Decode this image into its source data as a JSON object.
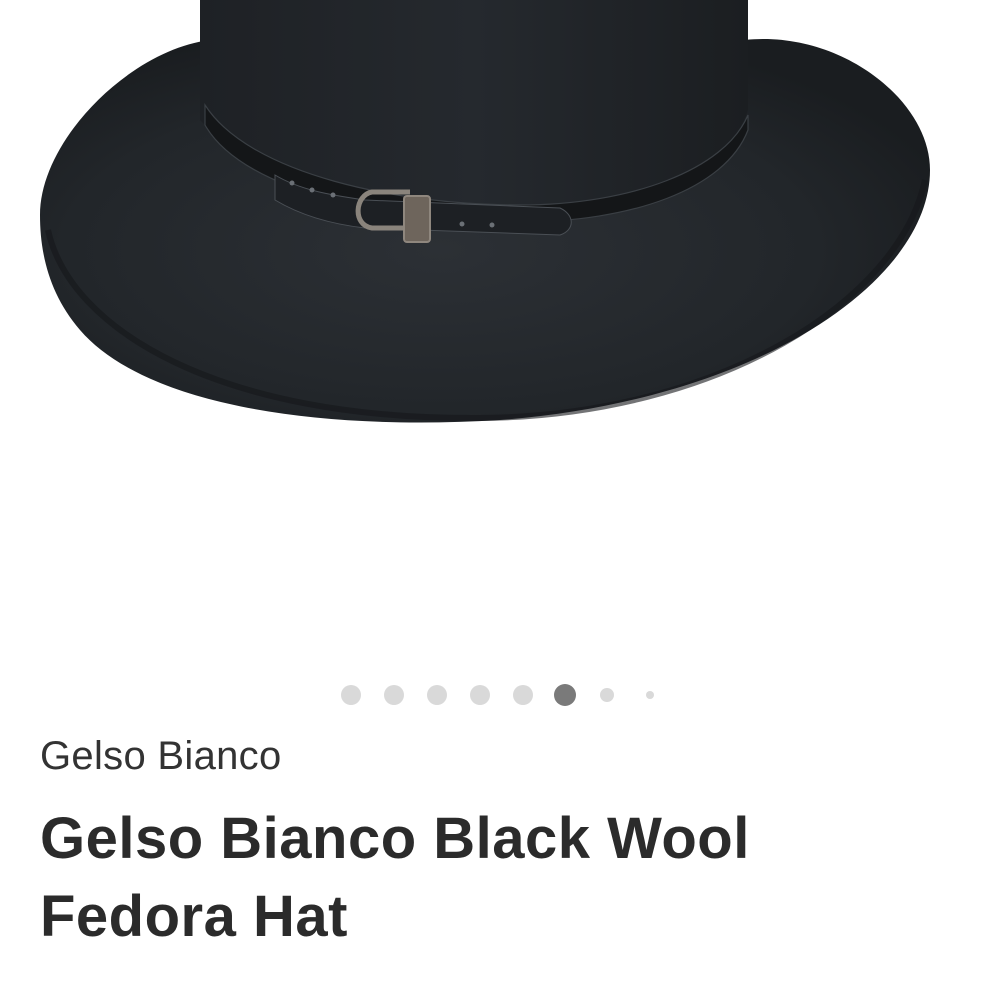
{
  "product": {
    "image_description_icon": "hat-image",
    "carousel": {
      "total": 8,
      "active_index": 5
    },
    "brand": "Gelso Bianco",
    "title": "Gelso Bianco Black Wool Fedora Hat"
  },
  "colors": {
    "hat": "#23272b",
    "dot_inactive": "#d9d9d9",
    "dot_active": "#7a7a7a",
    "text": "#2b2b2b"
  }
}
